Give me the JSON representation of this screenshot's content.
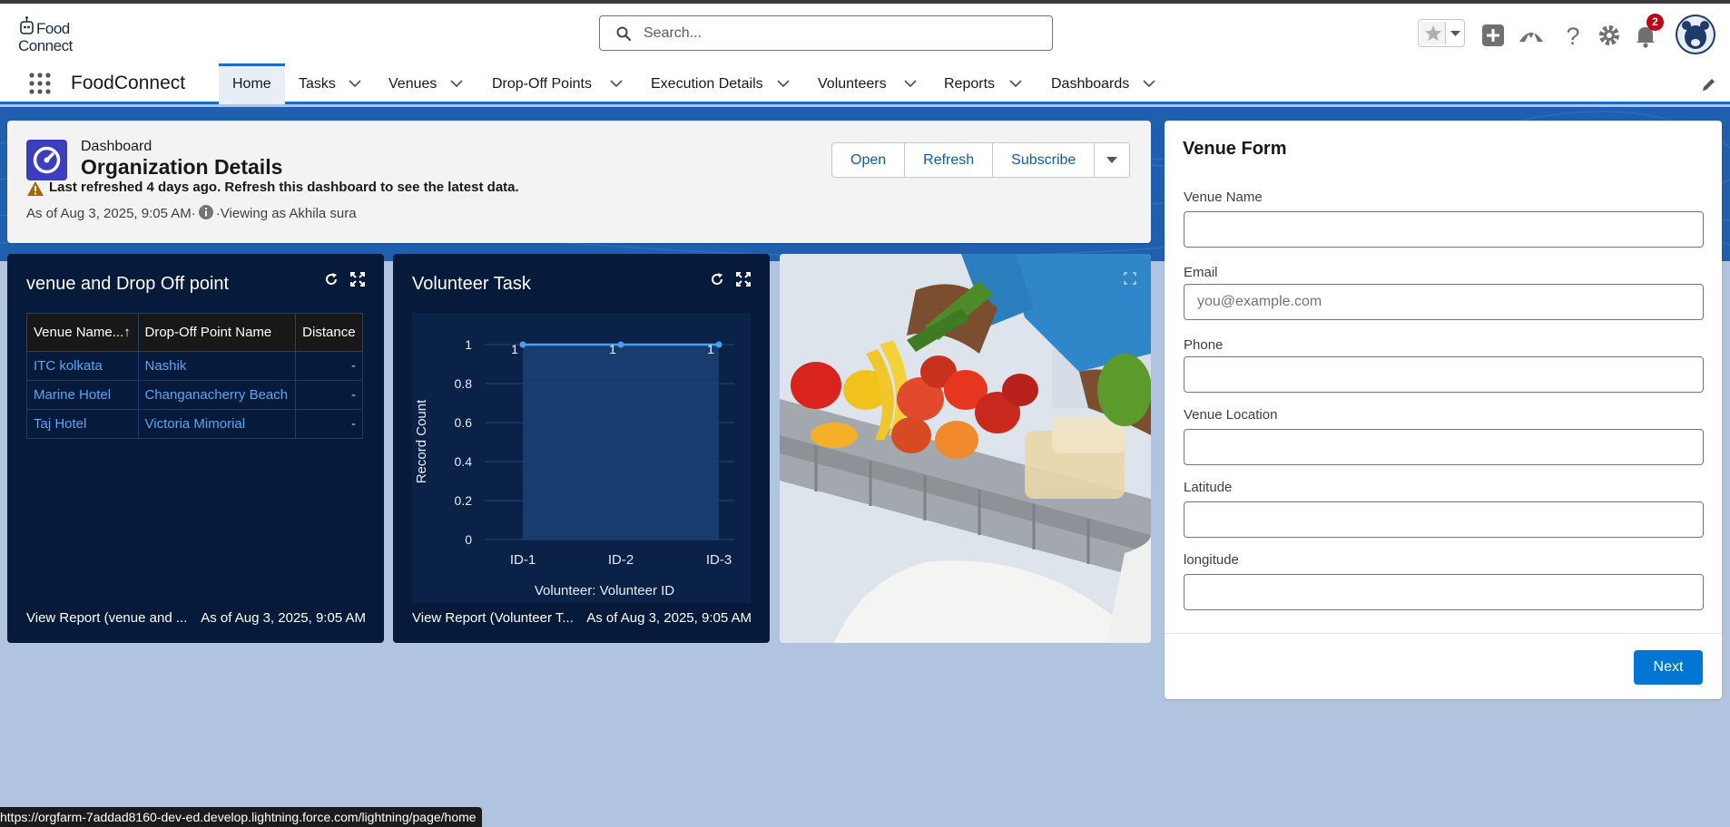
{
  "header": {
    "logo_line1": "Food",
    "logo_line2": "Connect",
    "search_placeholder": "Search...",
    "notification_count": "2"
  },
  "nav": {
    "app_name": "FoodConnect",
    "tabs": [
      {
        "label": "Home",
        "active": true
      },
      {
        "label": "Tasks"
      },
      {
        "label": "Venues"
      },
      {
        "label": "Drop-Off Points"
      },
      {
        "label": "Execution Details"
      },
      {
        "label": "Volunteers"
      },
      {
        "label": "Reports"
      },
      {
        "label": "Dashboards"
      }
    ]
  },
  "dashboard": {
    "label": "Dashboard",
    "title": "Organization Details",
    "warning": "Last refreshed 4 days ago. Refresh this dashboard to see the latest data.",
    "as_of": "As of Aug 3, 2025, 9:05 AM",
    "viewing_as": "Viewing as Akhila sura",
    "buttons": {
      "open": "Open",
      "refresh": "Refresh",
      "subscribe": "Subscribe"
    }
  },
  "widget1": {
    "title": "venue and Drop Off point",
    "columns": [
      "Venue Name",
      "Drop-Off Point Name",
      "Distance"
    ],
    "rows": [
      {
        "venue": "ITC kolkata",
        "dropoff": "Nashik",
        "distance": "-"
      },
      {
        "venue": "Marine Hotel",
        "dropoff": "Changanacherry Beach",
        "distance": "-"
      },
      {
        "venue": "Taj Hotel",
        "dropoff": "Victoria Mimorial",
        "distance": "-"
      }
    ],
    "footer_link": "View Report (venue and ...",
    "footer_asof": "As of Aug 3, 2025, 9:05 AM"
  },
  "widget2": {
    "title": "Volunteer Task",
    "footer_link": "View Report (Volunteer T...",
    "footer_asof": "As of Aug 3, 2025, 9:05 AM"
  },
  "chart_data": {
    "type": "line",
    "categories": [
      "ID-1",
      "ID-2",
      "ID-3"
    ],
    "values": [
      1,
      1,
      1
    ],
    "data_labels": [
      "1",
      "1",
      "1"
    ],
    "xlabel": "Volunteer: Volunteer ID",
    "ylabel": "Record Count",
    "ylim": [
      0,
      1
    ],
    "yticks": [
      "0",
      "0.2",
      "0.4",
      "0.6",
      "0.8",
      "1"
    ],
    "grid": true,
    "area_fill": true,
    "line_color": "#4aa0f0"
  },
  "form": {
    "title": "Venue Form",
    "fields": [
      {
        "label": "Venue Name",
        "value": "",
        "placeholder": ""
      },
      {
        "label": "Email",
        "value": "",
        "placeholder": "you@example.com"
      },
      {
        "label": "Phone",
        "value": "",
        "placeholder": ""
      },
      {
        "label": "Venue Location",
        "value": "",
        "placeholder": ""
      },
      {
        "label": "Latitude",
        "value": "",
        "placeholder": ""
      },
      {
        "label": "longitude",
        "value": "",
        "placeholder": ""
      }
    ],
    "next_label": "Next"
  },
  "status_url": "https://orgfarm-7addad8160-dev-ed.develop.lightning.force.com/lightning/page/home",
  "colors": {
    "brand_blue": "#0176d3",
    "widget_bg": "#061a3c",
    "link_blue": "#5ba6f2"
  }
}
